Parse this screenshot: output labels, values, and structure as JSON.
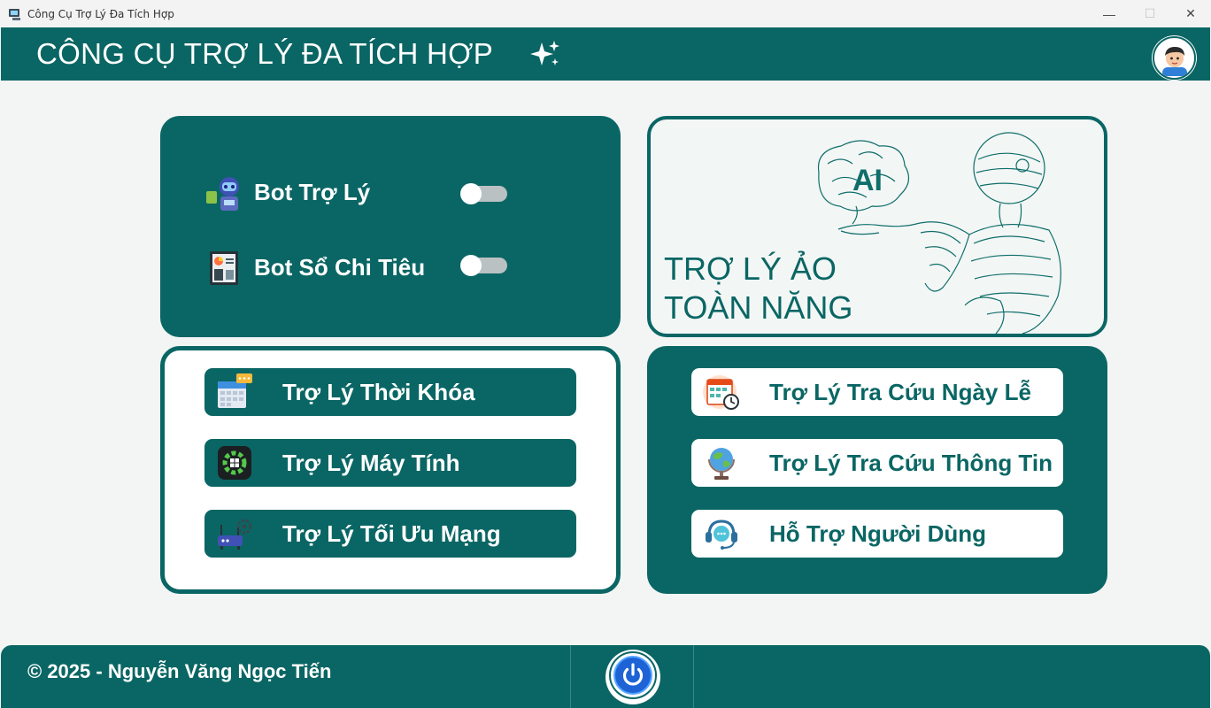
{
  "window": {
    "title": "Công Cụ Trợ Lý Đa Tích Hợp",
    "minimize_label": "—",
    "maximize_label": "☐",
    "close_label": "✕"
  },
  "header": {
    "title": "CÔNG CỤ TRỢ LÝ ĐA TÍCH HỢP",
    "avatar": "user-avatar"
  },
  "bots": [
    {
      "label": "Bot Trợ Lý",
      "icon": "robot-icon",
      "enabled": false
    },
    {
      "label": "Bot Sổ Chi Tiêu",
      "icon": "expense-report-icon",
      "enabled": false
    }
  ],
  "ai_card": {
    "line1": "TRỢ LÝ ẢO",
    "line2": "TOÀN NĂNG",
    "badge": "AI"
  },
  "left_buttons": [
    {
      "label": "Trợ Lý Thời Khóa",
      "icon": "calendar-icon"
    },
    {
      "label": "Trợ Lý Máy Tính",
      "icon": "computer-gear-icon"
    },
    {
      "label": "Trợ Lý Tối Ưu Mạng",
      "icon": "router-icon"
    }
  ],
  "right_buttons": [
    {
      "label": "Trợ Lý Tra Cứu Ngày Lễ",
      "icon": "holiday-calendar-icon"
    },
    {
      "label": "Trợ Lý Tra Cứu Thông Tin",
      "icon": "globe-icon"
    },
    {
      "label": "Hỗ Trợ Người Dùng",
      "icon": "support-headset-icon"
    }
  ],
  "footer": {
    "copyright": "©  2025 - Nguyễn Văng Ngọc Tiến",
    "power_icon": "power-icon"
  },
  "colors": {
    "primary": "#0a6664",
    "background": "#f2f5f4",
    "toggle_off": "#b9c1c3"
  }
}
